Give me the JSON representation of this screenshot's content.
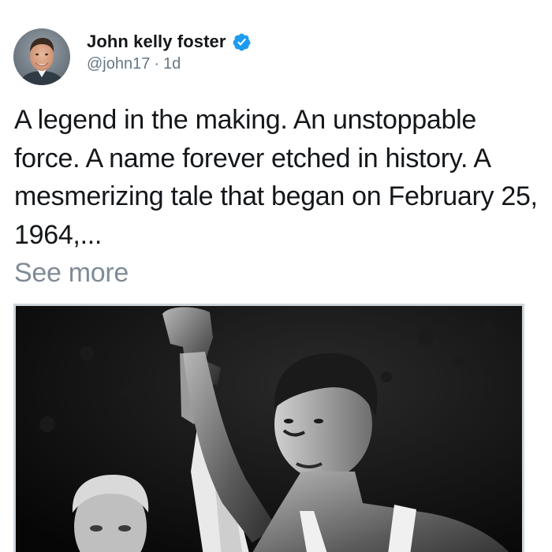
{
  "tweet": {
    "author": {
      "display_name": "John kelly foster",
      "handle": "@john17",
      "separator": "·",
      "time_ago": "1d",
      "verified": true,
      "avatar_icon": "user-avatar-photo"
    },
    "text": "A legend in the making. An unstoppable force. A name forever etched in history. A mesmerizing tale that began on February 25, 1964,...",
    "see_more_label": "See more",
    "media": {
      "type": "photo",
      "style": "black-and-white"
    }
  },
  "colors": {
    "primary_text": "#14171a",
    "secondary_text": "#657786",
    "see_more": "#7f8b96",
    "verified_badge": "#1d9bf0",
    "media_border": "#cfd6dc"
  }
}
